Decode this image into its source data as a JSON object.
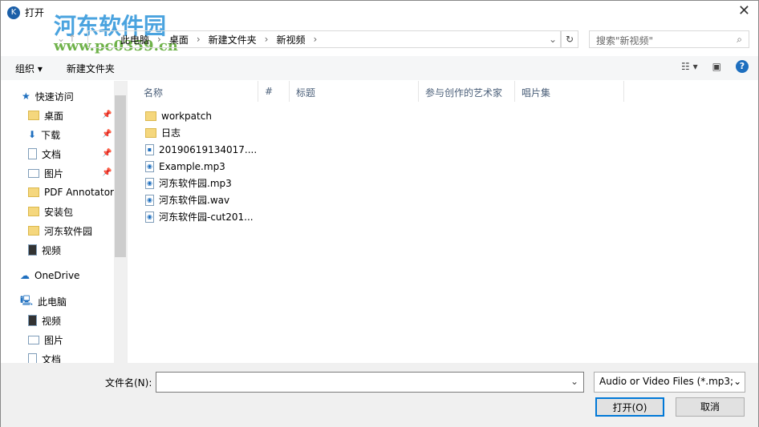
{
  "window": {
    "title": "打开",
    "close": "✕"
  },
  "watermark": {
    "name": "河东软件园",
    "url": "www.pc0359.cn"
  },
  "address": {
    "crumbs": [
      "此电脑",
      "桌面",
      "新建文件夹",
      "新视频"
    ],
    "search_placeholder": "搜索\"新视频\""
  },
  "toolbar": {
    "organize": "组织 ▾",
    "new_folder": "新建文件夹",
    "help": "?"
  },
  "nav": [
    {
      "label": "快速访问",
      "icon": "star-icon"
    },
    {
      "label": "桌面",
      "icon": "folder-icon",
      "pinned": true
    },
    {
      "label": "下载",
      "icon": "download-icon",
      "pinned": true
    },
    {
      "label": "文档",
      "icon": "document-icon",
      "pinned": true
    },
    {
      "label": "图片",
      "icon": "picture-icon",
      "pinned": true
    },
    {
      "label": "PDF Annotator",
      "icon": "folder-icon"
    },
    {
      "label": "安装包",
      "icon": "folder-icon"
    },
    {
      "label": "河东软件园",
      "icon": "folder-icon"
    },
    {
      "label": "视频",
      "icon": "video-icon"
    },
    {
      "label": "OneDrive",
      "icon": "cloud-icon"
    },
    {
      "label": "此电脑",
      "icon": "computer-icon"
    },
    {
      "label": "视频",
      "icon": "video-icon"
    },
    {
      "label": "图片",
      "icon": "picture-icon"
    },
    {
      "label": "文档",
      "icon": "document-icon"
    }
  ],
  "columns": [
    "名称",
    "#",
    "标题",
    "参与创作的艺术家",
    "唱片集"
  ],
  "files": [
    {
      "name": "workpatch",
      "type": "folder"
    },
    {
      "name": "日志",
      "type": "folder"
    },
    {
      "name": "20190619134017....",
      "type": "file"
    },
    {
      "name": "Example.mp3",
      "type": "audio"
    },
    {
      "name": "河东软件园.mp3",
      "type": "audio"
    },
    {
      "name": "河东软件园.wav",
      "type": "audio"
    },
    {
      "name": "河东软件园-cut201...",
      "type": "audio"
    }
  ],
  "footer": {
    "filename_label": "文件名(N):",
    "filename_value": "",
    "filetype": "Audio or Video Files (*.mp3;",
    "open": "打开(O)",
    "cancel": "取消"
  }
}
